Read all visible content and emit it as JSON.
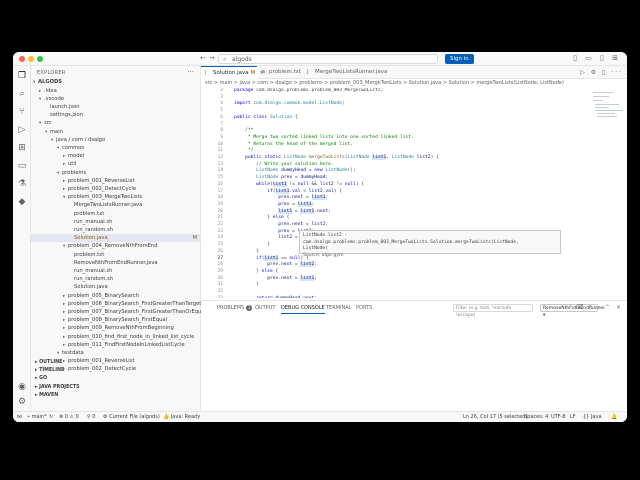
{
  "titlebar": {
    "search_text": "algods",
    "signin_label": "Sign in"
  },
  "sidebar": {
    "title": "EXPLORER",
    "root": "ALGODS",
    "tree": [
      {
        "label": ".idea",
        "depth": 1,
        "folder": true,
        "open": false
      },
      {
        "label": ".vscode",
        "depth": 1,
        "folder": true,
        "open": true
      },
      {
        "label": "launch.json",
        "depth": 2,
        "folder": false
      },
      {
        "label": "settings.json",
        "depth": 2,
        "folder": false
      },
      {
        "label": "src",
        "depth": 1,
        "folder": true,
        "open": true
      },
      {
        "label": "main",
        "depth": 2,
        "folder": true,
        "open": true
      },
      {
        "label": "java / com / dsalgo",
        "depth": 3,
        "folder": true,
        "open": true
      },
      {
        "label": "common",
        "depth": 4,
        "folder": true,
        "open": true
      },
      {
        "label": "model",
        "depth": 5,
        "folder": true,
        "open": false
      },
      {
        "label": "util",
        "depth": 5,
        "folder": true,
        "open": false
      },
      {
        "label": "problems",
        "depth": 4,
        "folder": true,
        "open": true
      },
      {
        "label": "problem_001_ReverseList",
        "depth": 5,
        "folder": true,
        "open": false
      },
      {
        "label": "problem_002_DetectCycle",
        "depth": 5,
        "folder": true,
        "open": false
      },
      {
        "label": "problem_003_MergeTwoLists",
        "depth": 5,
        "folder": true,
        "open": true
      },
      {
        "label": "MergeTwoListsRunner.java",
        "depth": 6,
        "folder": false
      },
      {
        "label": "problem.txt",
        "depth": 6,
        "folder": false
      },
      {
        "label": "run_manual.sh",
        "depth": 6,
        "folder": false
      },
      {
        "label": "run_random.sh",
        "depth": 6,
        "folder": false
      },
      {
        "label": "Solution.java",
        "depth": 6,
        "folder": false,
        "selected": true,
        "flag": "M"
      },
      {
        "label": "problem_004_RemoveNthFromEnd",
        "depth": 5,
        "folder": true,
        "open": true
      },
      {
        "label": "problem.txt",
        "depth": 6,
        "folder": false
      },
      {
        "label": "RemoveNthFromEndRunner.java",
        "depth": 6,
        "folder": false
      },
      {
        "label": "run_manual.sh",
        "depth": 6,
        "folder": false
      },
      {
        "label": "run_random.sh",
        "depth": 6,
        "folder": false
      },
      {
        "label": "Solution.java",
        "depth": 6,
        "folder": false
      },
      {
        "label": "problem_005_BinarySearch",
        "depth": 5,
        "folder": true,
        "open": false
      },
      {
        "label": "problem_006_BinarySearch_FirstGreaterThanTarget",
        "depth": 5,
        "folder": true,
        "open": false
      },
      {
        "label": "problem_007_BinarySearch_FirstGreaterThanOrEqualToTarget",
        "depth": 5,
        "folder": true,
        "open": false
      },
      {
        "label": "problem_008_BinarySearch_FirstEqual",
        "depth": 5,
        "folder": true,
        "open": false
      },
      {
        "label": "problem_009_RemoveNthFromBeginning",
        "depth": 5,
        "folder": true,
        "open": false
      },
      {
        "label": "problem_010_find_first_node_in_linked_list_cycle",
        "depth": 5,
        "folder": true,
        "open": false
      },
      {
        "label": "problem_011_FindFirstNodeInLinkedListCycle",
        "depth": 5,
        "folder": true,
        "open": false
      },
      {
        "label": "testdata",
        "depth": 4,
        "folder": true,
        "open": true
      },
      {
        "label": "problem_001_ReverseList",
        "depth": 5,
        "folder": true,
        "open": false
      },
      {
        "label": "problem_002_DetectCycle",
        "depth": 5,
        "folder": true,
        "open": false
      }
    ],
    "sections": [
      "OUTLINE",
      "TIMELINE",
      "GO",
      "JAVA PROJECTS",
      "MAVEN"
    ]
  },
  "tabs": [
    {
      "label": "Solution.java",
      "suffix": "M",
      "active": true
    },
    {
      "label": "problem.txt",
      "active": false
    },
    {
      "label": "MergeTwoListsRunner.java",
      "active": false
    }
  ],
  "breadcrumb": "src > main > java > com > dsalgo > problems > problem_003_MergeTwoLists > Solution.java > Solution > mergeTwoLists(ListNode, ListNode)",
  "hover": {
    "signature": "ListNode list2 - com.dsalgo.problems.problem_003_MergeTwoLists.Solution.mergeTwoLists(ListNode,",
    "signature2": "ListNode)",
    "source": "Source: algo-gym"
  },
  "panel": {
    "tabs": [
      "PROBLEMS",
      "OUTPUT",
      "DEBUG CONSOLE",
      "TERMINAL",
      "PORTS"
    ],
    "problems_count": "2",
    "filter_placeholder": "Filter (e.g. text, !exclude, \\escape)",
    "select_value": "RemoveNthFromEndRunner"
  },
  "status": {
    "branch": "main*",
    "sync": "↻",
    "errors": "⊗ 0 ⚠ 0",
    "ports": "⚲ 0",
    "current_file": "Current File (algods)",
    "java": "Java: Ready",
    "cursor": "Ln 26, Col 17 (5 selected)",
    "spaces": "Spaces: 4",
    "encoding": "UTF-8",
    "eol": "LF",
    "lang": "{} Java"
  }
}
